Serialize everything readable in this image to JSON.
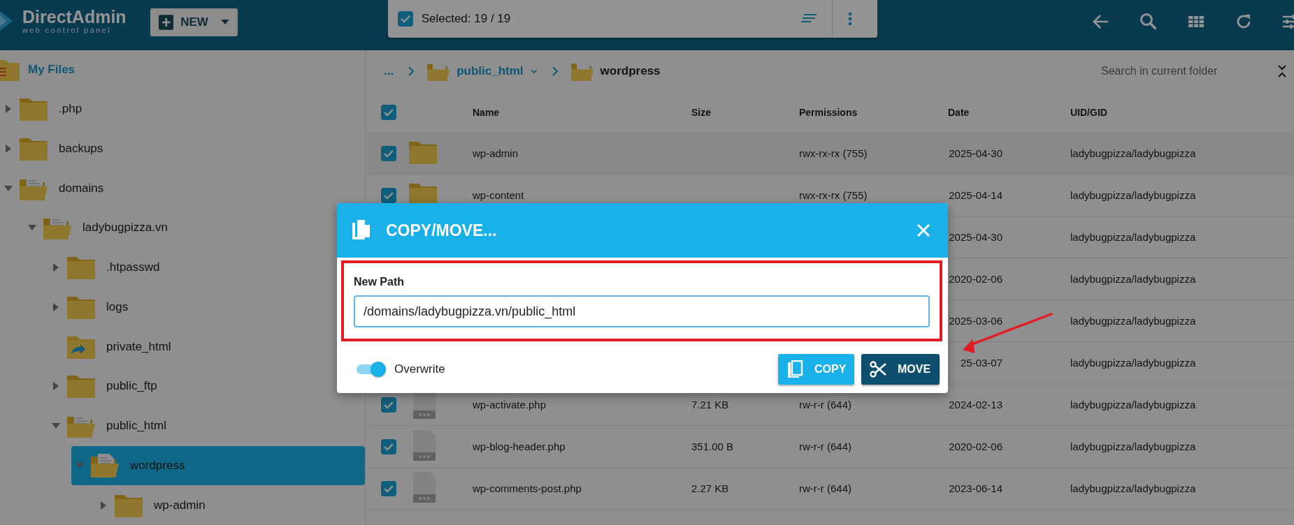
{
  "header": {
    "logo": {
      "name": "DirectAdmin",
      "tagline": "web control panel"
    },
    "new_button": "NEW",
    "selection": {
      "checked": true,
      "label": "Selected: 19 / 19"
    }
  },
  "tree": {
    "root": "My Files",
    "items": [
      {
        "label": ".php",
        "kind": "folder",
        "expanded": false,
        "selected": false
      },
      {
        "label": "backups",
        "kind": "folder",
        "expanded": false,
        "selected": false
      },
      {
        "label": "domains",
        "kind": "folder",
        "expanded": true,
        "selected": false,
        "children": [
          {
            "label": "ladybugpizza.vn",
            "kind": "folder",
            "expanded": true,
            "selected": false,
            "children": [
              {
                "label": ".htpasswd",
                "kind": "folder",
                "expanded": false,
                "selected": false
              },
              {
                "label": "logs",
                "kind": "folder",
                "expanded": false,
                "selected": false
              },
              {
                "label": "private_html",
                "kind": "symlink",
                "selected": false
              },
              {
                "label": "public_ftp",
                "kind": "folder",
                "expanded": false,
                "selected": false
              },
              {
                "label": "public_html",
                "kind": "folder",
                "expanded": true,
                "selected": false,
                "children": [
                  {
                    "label": "wordpress",
                    "kind": "folder",
                    "expanded": true,
                    "selected": true,
                    "children": [
                      {
                        "label": "wp-admin",
                        "kind": "folder",
                        "expanded": false,
                        "selected": false
                      }
                    ]
                  }
                ]
              }
            ]
          }
        ]
      }
    ]
  },
  "breadcrumb": [
    {
      "label": "...",
      "kind": "more"
    },
    {
      "label": "public_html",
      "kind": "dropdown"
    },
    {
      "label": "wordpress",
      "kind": "current"
    }
  ],
  "search": {
    "placeholder": "Search in current folder"
  },
  "table": {
    "select_all": true,
    "columns": [
      "Name",
      "Size",
      "Permissions",
      "Date",
      "UID/GID"
    ],
    "rows": [
      {
        "checked": true,
        "kind": "folder",
        "name": "wp-admin",
        "permissions": "rwx-rx-rx (755)",
        "date": "2025-04-30",
        "uid": "ladybugpizza/ladybugpizza"
      },
      {
        "checked": true,
        "kind": "folder",
        "name": "wp-content",
        "permissions": "rwx-rx-rx (755)",
        "date": "2025-04-14",
        "uid": "ladybugpizza/ladybugpizza"
      },
      {
        "date": "2025-04-30",
        "uid": "ladybugpizza/ladybugpizza"
      },
      {
        "date": "2020-02-06",
        "uid": "ladybugpizza/ladybugpizza"
      },
      {
        "date": "2025-03-06",
        "uid": "ladybugpizza/ladybugpizza"
      },
      {
        "date": "25-03-07",
        "uid": "ladybugpizza/ladybugpizza"
      },
      {
        "checked": true,
        "kind": "file",
        "name": "wp-activate.php",
        "size": "7.21 KB",
        "permissions": "rw-r-r (644)",
        "date": "2024-02-13",
        "uid": "ladybugpizza/ladybugpizza"
      },
      {
        "checked": true,
        "kind": "file",
        "name": "wp-blog-header.php",
        "size": "351.00 B",
        "permissions": "rw-r-r (644)",
        "date": "2020-02-06",
        "uid": "ladybugpizza/ladybugpizza"
      },
      {
        "checked": true,
        "kind": "file",
        "name": "wp-comments-post.php",
        "size": "2.27 KB",
        "permissions": "rw-r-r (644)",
        "date": "2023-06-14",
        "uid": "ladybugpizza/ladybugpizza"
      }
    ]
  },
  "dialog": {
    "title": "COPY/MOVE...",
    "field": {
      "label": "New Path",
      "value": "/domains/ladybugpizza.vn/public_html"
    },
    "overwrite": {
      "label": "Overwrite",
      "on": true
    },
    "buttons": [
      {
        "label": "COPY",
        "kind": "copy"
      },
      {
        "label": "MOVE",
        "kind": "move"
      }
    ]
  }
}
